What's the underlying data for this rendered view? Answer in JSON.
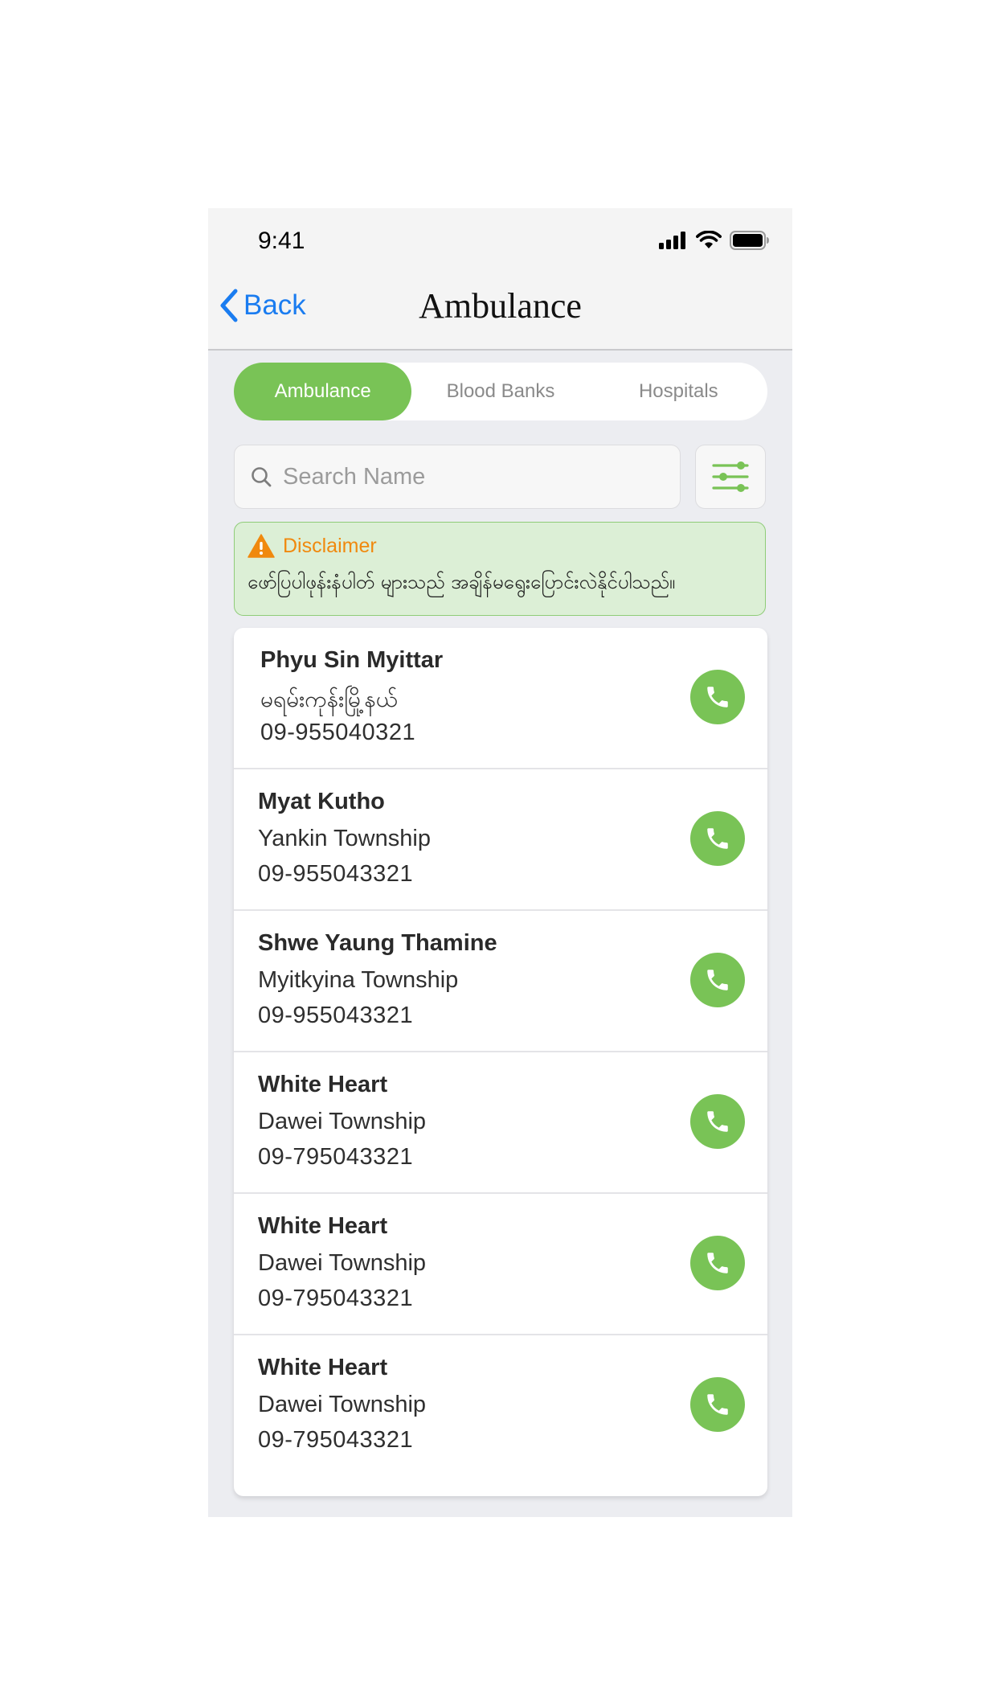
{
  "status_bar": {
    "time": "9:41",
    "icons": [
      "cellular-signal-icon",
      "wifi-icon",
      "battery-icon"
    ]
  },
  "nav": {
    "back_label": "Back",
    "title": "Ambulance"
  },
  "tabs": [
    {
      "label": "Ambulance",
      "active": true
    },
    {
      "label": "Blood Banks",
      "active": false
    },
    {
      "label": "Hospitals",
      "active": false
    }
  ],
  "search": {
    "placeholder": "Search Name",
    "value": ""
  },
  "disclaimer": {
    "title": "Disclaimer",
    "text": "ဖော်ပြပါဖုန်းနံပါတ် များသည် အချိန်မရွေးပြောင်းလဲနိုင်ပါသည်။"
  },
  "contacts": [
    {
      "name": "Phyu Sin Myittar",
      "area": "မရမ်းကုန်းမြို့နယ်",
      "phone": "09-955040321"
    },
    {
      "name": "Myat Kutho",
      "area": "Yankin Township",
      "phone": "09-955043321"
    },
    {
      "name": "Shwe Yaung Thamine",
      "area": "Myitkyina Township",
      "phone": "09-955043321"
    },
    {
      "name": "White Heart",
      "area": "Dawei Township",
      "phone": "09-795043321"
    },
    {
      "name": "White Heart",
      "area": "Dawei Township",
      "phone": "09-795043321"
    },
    {
      "name": "White Heart",
      "area": "Dawei Township",
      "phone": "09-795043321"
    }
  ],
  "colors": {
    "accent_green": "#79c356",
    "ios_blue": "#1a7cf0",
    "warning_orange": "#f0890e",
    "disclaimer_bg": "#dcefd6"
  }
}
